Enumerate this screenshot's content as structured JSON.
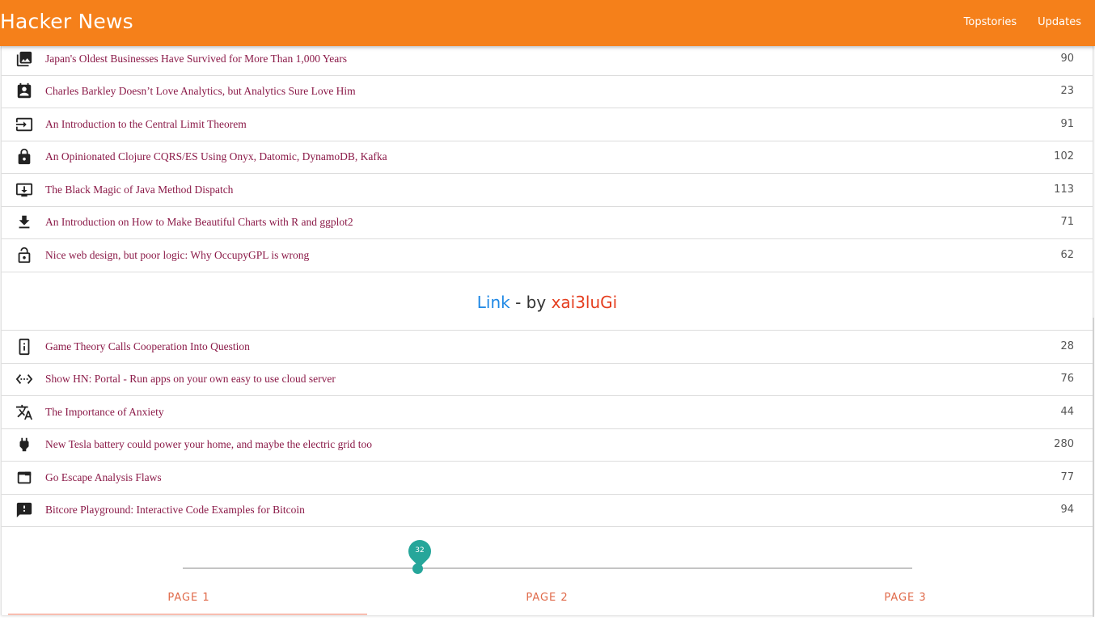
{
  "app": {
    "title": "Hacker News",
    "nav": [
      "Topstories",
      "Updates"
    ]
  },
  "stories_top": [
    {
      "icon": "photo-album-icon",
      "title": "Japan's Oldest Businesses Have Survived for More Than 1,000 Years",
      "score": "90"
    },
    {
      "icon": "contact-card-icon",
      "title": "Charles Barkley Doesn’t Love Analytics, but Analytics Sure Love Him",
      "score": "23"
    },
    {
      "icon": "input-icon",
      "title": "An Introduction to the Central Limit Theorem",
      "score": "91"
    },
    {
      "icon": "lock-icon",
      "title": "An Opinionated Clojure CQRS/ES Using Onyx, Datomic, DynamoDB, Kafka",
      "score": "102"
    },
    {
      "icon": "system-update-icon",
      "title": "The Black Magic of Java Method Dispatch",
      "score": "113"
    },
    {
      "icon": "download-icon",
      "title": "An Introduction on How to Make Beautiful Charts with R and ggplot2",
      "score": "71"
    },
    {
      "icon": "lock-open-icon",
      "title": "Nice web design, but poor logic: Why OccupyGPL is wrong",
      "score": "62"
    }
  ],
  "credit": {
    "link_label": "Link",
    "separator": " - by ",
    "author": "xai3luGi"
  },
  "stories_bottom": [
    {
      "icon": "device-info-icon",
      "title": "Game Theory Calls Cooperation Into Question",
      "score": "28"
    },
    {
      "icon": "settings-ethernet-icon",
      "title": "Show HN: Portal - Run apps on your own easy to use cloud server",
      "score": "76"
    },
    {
      "icon": "translate-icon",
      "title": "The Importance of Anxiety",
      "score": "44"
    },
    {
      "icon": "power-plug-icon",
      "title": "New Tesla battery could power your home, and maybe the electric grid too",
      "score": "280"
    },
    {
      "icon": "web-asset-icon",
      "title": "Go Escape Analysis Flaws",
      "score": "77"
    },
    {
      "icon": "feedback-icon",
      "title": "Bitcore Playground: Interactive Code Examples for Bitcoin",
      "score": "94"
    }
  ],
  "slider": {
    "value": "32",
    "fraction": 0.32
  },
  "tabs": [
    "PAGE 1",
    "PAGE 2",
    "PAGE 3"
  ],
  "colors": {
    "appbar": "#f5801a",
    "story_link": "#8b1a48",
    "credit_link": "#1e88e5",
    "credit_author": "#e53e1f",
    "slider_accent": "#26a69a",
    "tab_text": "#e06a4a"
  }
}
